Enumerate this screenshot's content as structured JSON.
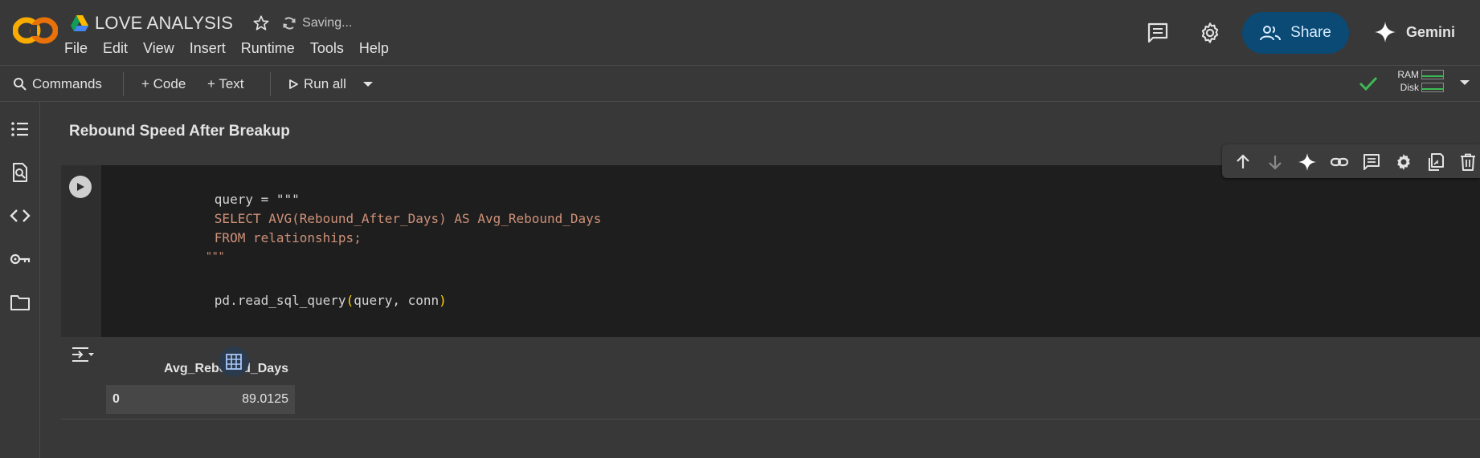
{
  "header": {
    "title": "LOVE ANALYSIS",
    "saving_status": "Saving...",
    "menu": [
      "File",
      "Edit",
      "View",
      "Insert",
      "Runtime",
      "Tools",
      "Help"
    ],
    "share_label": "Share",
    "gemini_label": "Gemini",
    "colors": {
      "share_bg": "#0a4a75",
      "logo_orange": "#f9ab00",
      "logo_dark_orange": "#e8710a"
    }
  },
  "toolbar": {
    "commands_label": "Commands",
    "code_label": "+ Code",
    "text_label": "+ Text",
    "run_all_label": "Run all",
    "ram_label": "RAM",
    "disk_label": "Disk"
  },
  "rail": {
    "icons": [
      "table-of-contents-icon",
      "find-replace-icon",
      "code-snippets-icon",
      "secrets-key-icon",
      "files-folder-icon"
    ]
  },
  "notebook": {
    "section_title": "Rebound Speed After Breakup",
    "cell_toolbar_icons": [
      "move-up-icon",
      "move-down-icon",
      "gemini-sparkle-icon",
      "link-icon",
      "comment-icon",
      "settings-icon",
      "mirror-cell-icon",
      "delete-icon"
    ],
    "code": {
      "line1": "query = \"\"\"",
      "line2": "SELECT AVG(Rebound_After_Days) AS Avg_Rebound_Days",
      "line3": "FROM relationships;",
      "line4": "\"\"\"",
      "line5_a": "pd.read_sql_query",
      "line5_b": "(",
      "line5_c": "query, conn",
      "line5_d": ")"
    },
    "output": {
      "columns": [
        "Avg_Rebound_Days"
      ],
      "rows": [
        {
          "index": "0",
          "values": [
            "89.0125"
          ]
        }
      ]
    }
  }
}
